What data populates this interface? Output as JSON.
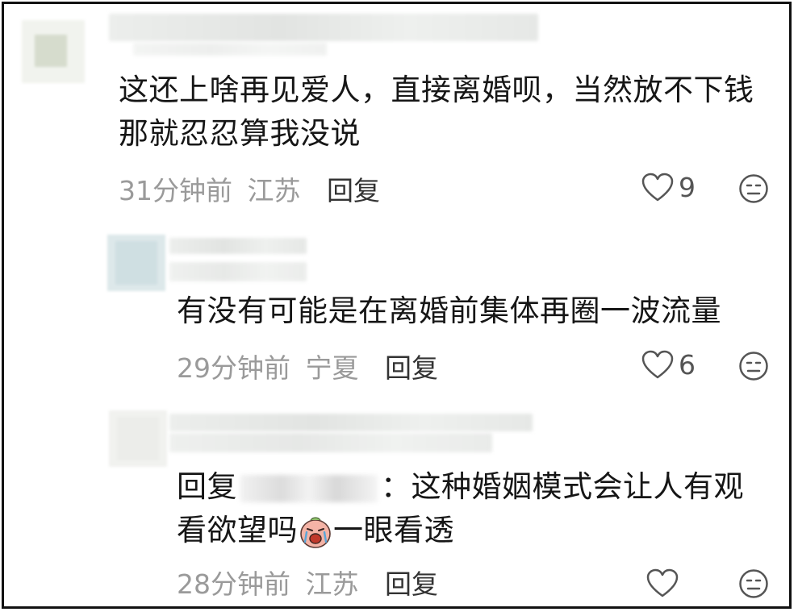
{
  "comments": [
    {
      "text": "这还上啥再见爱人，直接离婚呗，当然放不下钱那就忍忍算我没说",
      "time": "31分钟前",
      "location": "江苏",
      "reply_label": "回复",
      "likes": "9"
    },
    {
      "text": "有没有可能是在离婚前集体再圈一波流量",
      "time": "29分钟前",
      "location": "宁夏",
      "reply_label": "回复",
      "likes": "6"
    },
    {
      "reply_prefix": "回复",
      "separator": "：",
      "text_line1": "这种婚姻模式会让人有观",
      "text_line2_a": "看欲望吗",
      "emoji_name": "crying-face-emoji",
      "text_line2_b": "一眼看透",
      "time": "28分钟前",
      "location": "江苏",
      "reply_label": "回复",
      "likes": ""
    }
  ],
  "icons": {
    "like": "heart-outline-icon",
    "dislike": "meh-face-icon"
  },
  "colors": {
    "meta": "#9a9a9a",
    "text": "#161616",
    "border": "#111111"
  }
}
